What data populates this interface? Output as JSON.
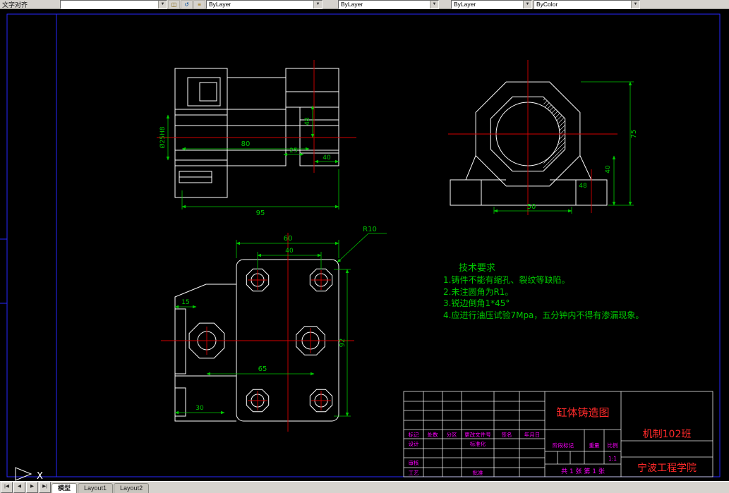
{
  "toolbar": {
    "label": "文字对齐",
    "layer_combo": "",
    "color_combo": "ByLayer",
    "linetype_combo": "ByLayer",
    "lineweight_combo": "ByLayer",
    "plotstyle_combo": "ByColor"
  },
  "statusbar": {
    "tabs": [
      "模型",
      "Layout1",
      "Layout2"
    ]
  },
  "drawing": {
    "views": {
      "front": {
        "dims": {
          "bore": "Ø25H8",
          "len80": "80",
          "len25": "25",
          "len40": "40",
          "len48": "48",
          "len95": "95"
        }
      },
      "side": {
        "dims": {
          "h75": "75",
          "h40": "40",
          "w50": "50",
          "w48": "48"
        }
      },
      "plan": {
        "dims": {
          "w60": "60",
          "w40": "40",
          "w15": "15",
          "h92": "92",
          "w65": "65",
          "w30": "30",
          "radius": "R10"
        }
      }
    },
    "tech_requirements": {
      "title": "技术要求",
      "items": [
        "1.铸件不能有缩孔、裂纹等缺陷。",
        "2.未注圆角为R1。",
        "3.锐边倒角1*45°",
        "4.应进行油压试验7Mpa，五分钟内不得有渗漏现象。"
      ]
    },
    "title_block": {
      "drawing_title": "缸体铸造图",
      "class_name": "机制102班",
      "organization": "宁波工程学院",
      "header_row": [
        "标记",
        "处数",
        "分区",
        "更改文件号",
        "签名",
        "年月日"
      ],
      "design": "设计",
      "standardization": "标准化",
      "audit": "审核",
      "process": "工艺",
      "approve": "批准",
      "stage_mark": "阶段标记",
      "weight": "重量",
      "scale_label": "比例",
      "scale_value": "1:1",
      "sheet_info": "共 1 张 第 1 张"
    },
    "ucs_label": "X"
  },
  "colors": {
    "background": "#000000",
    "geometry": "#ffffff",
    "dimensions": "#00c800",
    "centerlines": "#d40000",
    "frame": "#2828ff",
    "titles": "#ff2a2a",
    "labels": "#ff00ff"
  }
}
